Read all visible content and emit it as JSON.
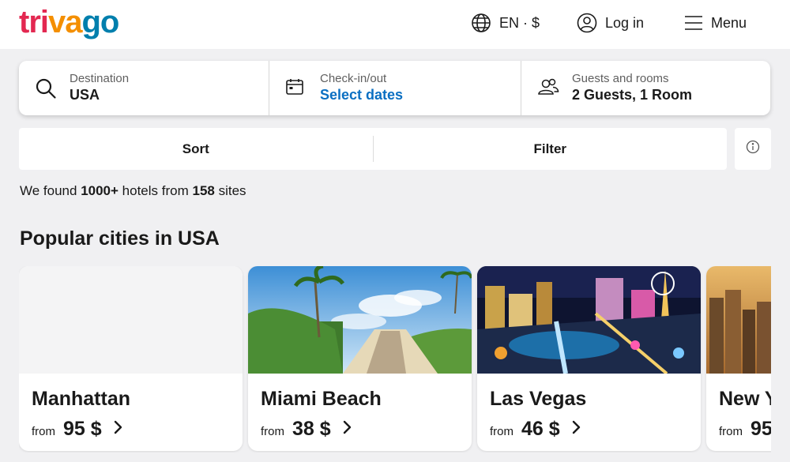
{
  "header": {
    "logo": {
      "part1": "tri",
      "part2": "va",
      "part3": "go"
    },
    "language_currency": "EN · $",
    "login_label": "Log in",
    "menu_label": "Menu",
    "icons": [
      "globe-icon",
      "user-icon",
      "hamburger-icon"
    ]
  },
  "search": {
    "destination": {
      "label": "Destination",
      "value": "USA",
      "icon": "search-icon"
    },
    "dates": {
      "label": "Check-in/out",
      "value": "Select dates",
      "icon": "calendar-icon"
    },
    "guests": {
      "label": "Guests and rooms",
      "value": "2 Guests, 1 Room",
      "icon": "guests-icon"
    }
  },
  "toolbar": {
    "sort_label": "Sort",
    "filter_label": "Filter",
    "info_icon": "info-icon"
  },
  "results": {
    "prefix": "We found ",
    "hotel_count": "1000+",
    "middle": " hotels from ",
    "site_count": "158",
    "suffix": " sites"
  },
  "popular": {
    "title": "Popular cities in USA",
    "cities": [
      {
        "name": "Manhattan",
        "from_label": "from",
        "price": "95 $"
      },
      {
        "name": "Miami Beach",
        "from_label": "from",
        "price": "38 $"
      },
      {
        "name": "Las Vegas",
        "from_label": "from",
        "price": "46 $"
      },
      {
        "name": "New Y",
        "from_label": "from",
        "price": "95"
      }
    ]
  },
  "colors": {
    "brand_red": "#e32851",
    "brand_orange": "#f48f00",
    "brand_blue": "#007fad",
    "link_blue": "#0a6fc2",
    "background": "#f0f0f2"
  }
}
